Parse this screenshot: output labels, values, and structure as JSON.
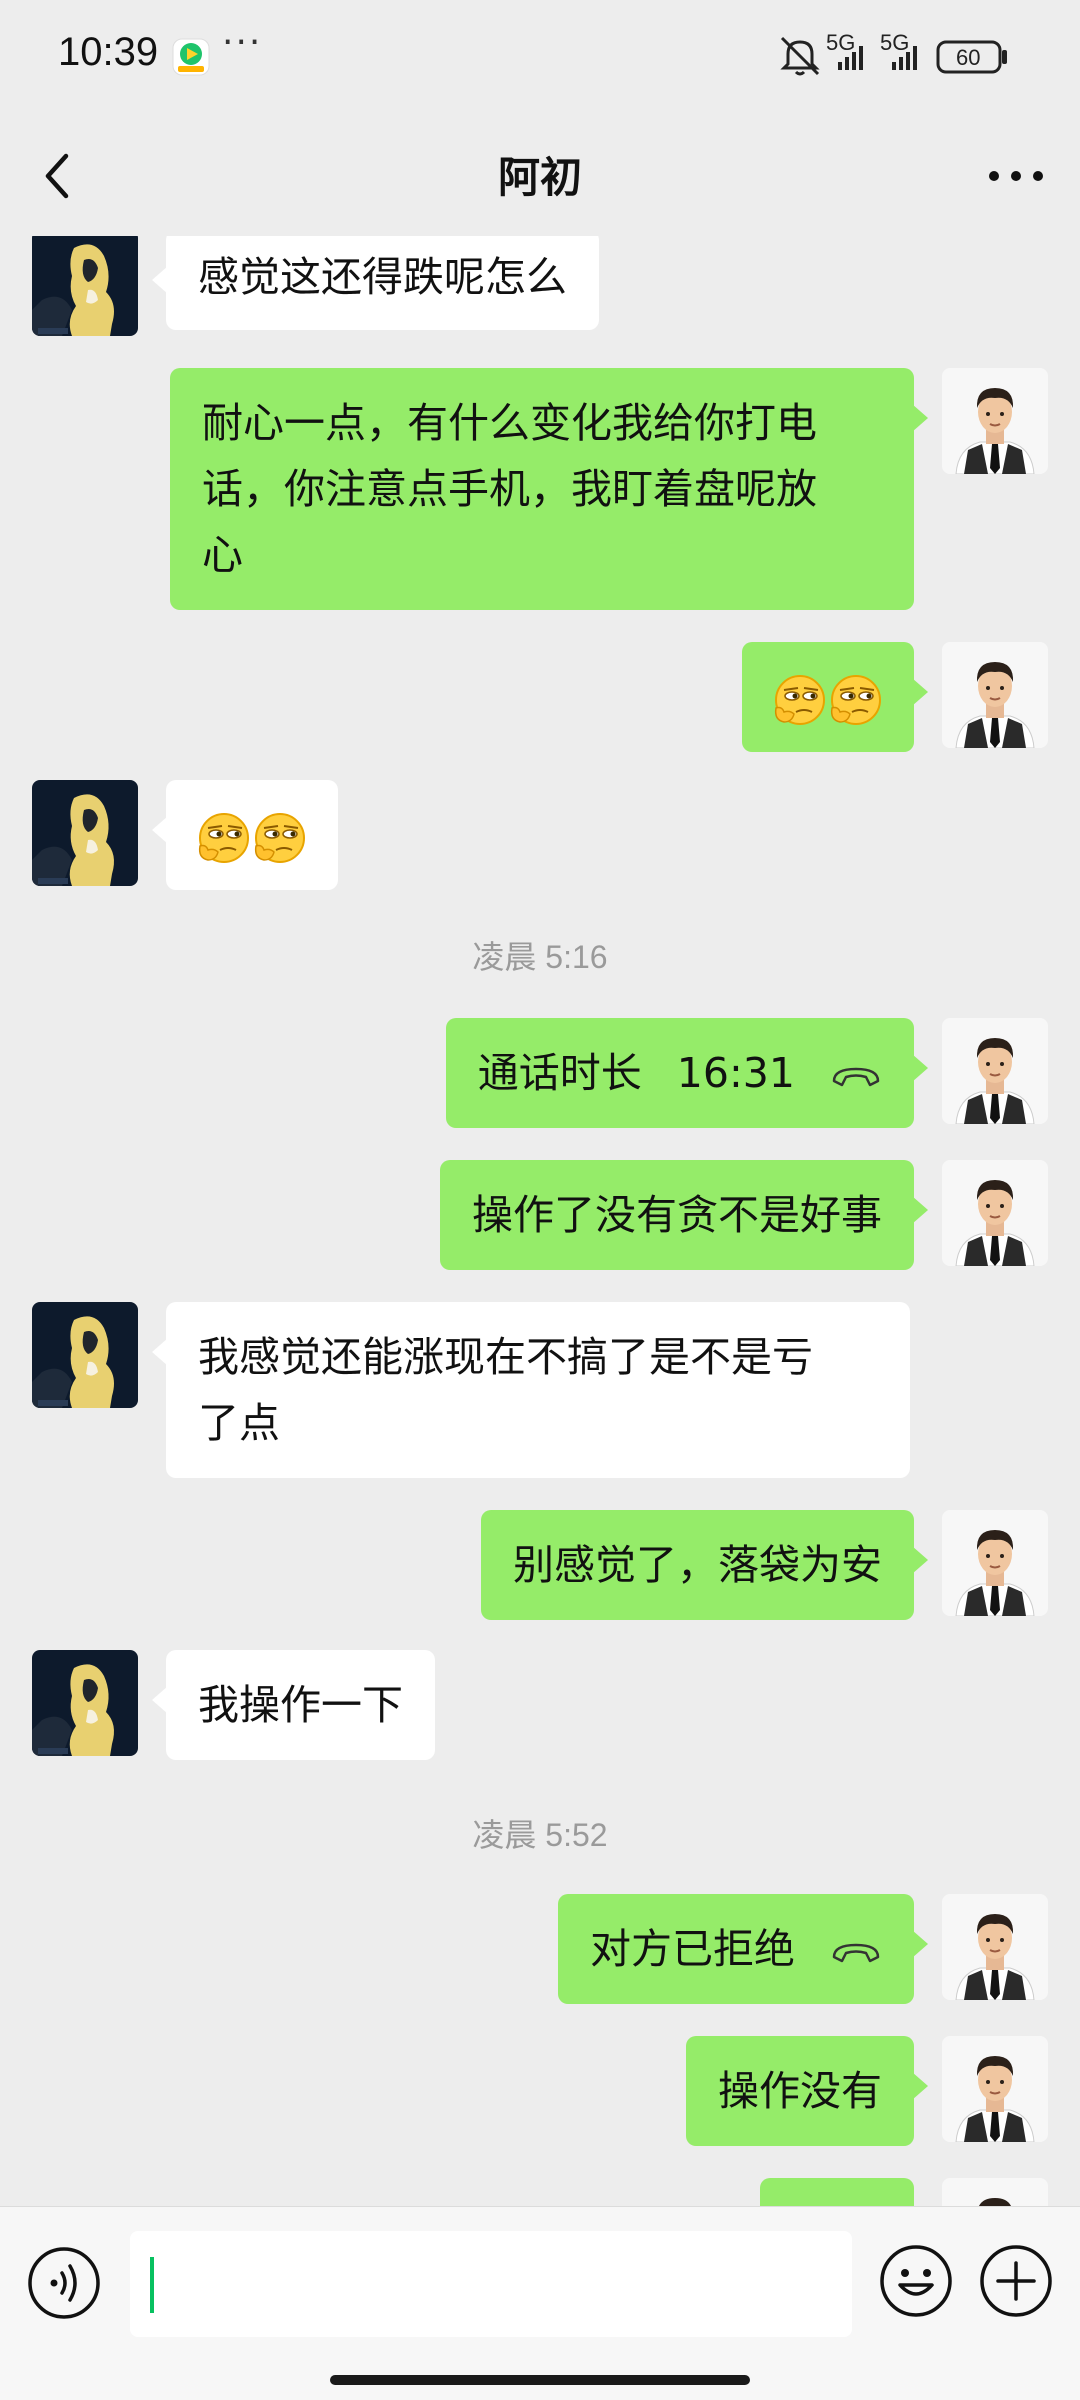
{
  "status_bar": {
    "time": "10:39",
    "more": "···",
    "network_1": "5G",
    "network_2": "5G",
    "battery": "60"
  },
  "header": {
    "title": "阿初"
  },
  "messages": [
    {
      "side": "in",
      "text": "感觉这还得跌呢怎么"
    },
    {
      "side": "out",
      "lines": [
        "耐心一点，有什么变化我给你打电",
        "话，你注意点手机，我盯着盘呢放",
        "心"
      ]
    },
    {
      "side": "out",
      "emoji": "smirk-emoji-pair"
    },
    {
      "side": "in",
      "emoji": "smirk-emoji-pair"
    },
    {
      "timestamp": "凌晨 5:16"
    },
    {
      "side": "out",
      "call": true,
      "label": "通话时长",
      "duration": "16:31"
    },
    {
      "side": "out",
      "text": "操作了没有贪不是好事"
    },
    {
      "side": "in",
      "lines": [
        "我感觉还能涨现在不搞了是不是亏",
        "了点"
      ]
    },
    {
      "side": "out",
      "text": "别感觉了，落袋为安"
    },
    {
      "side": "in",
      "text": "我操作一下"
    },
    {
      "timestamp": "凌晨 5:52"
    },
    {
      "side": "out",
      "call": true,
      "label": "对方已拒绝"
    },
    {
      "side": "out",
      "text": "操作没有"
    }
  ],
  "input": {
    "value": ""
  },
  "colors": {
    "outgoing_bubble": "#95ec69",
    "incoming_bubble": "#ffffff",
    "background": "#ededed",
    "caret": "#07c160"
  },
  "icons": [
    "back-icon",
    "more-icon",
    "voice-icon",
    "emoji-icon",
    "plus-icon",
    "call-icon"
  ]
}
